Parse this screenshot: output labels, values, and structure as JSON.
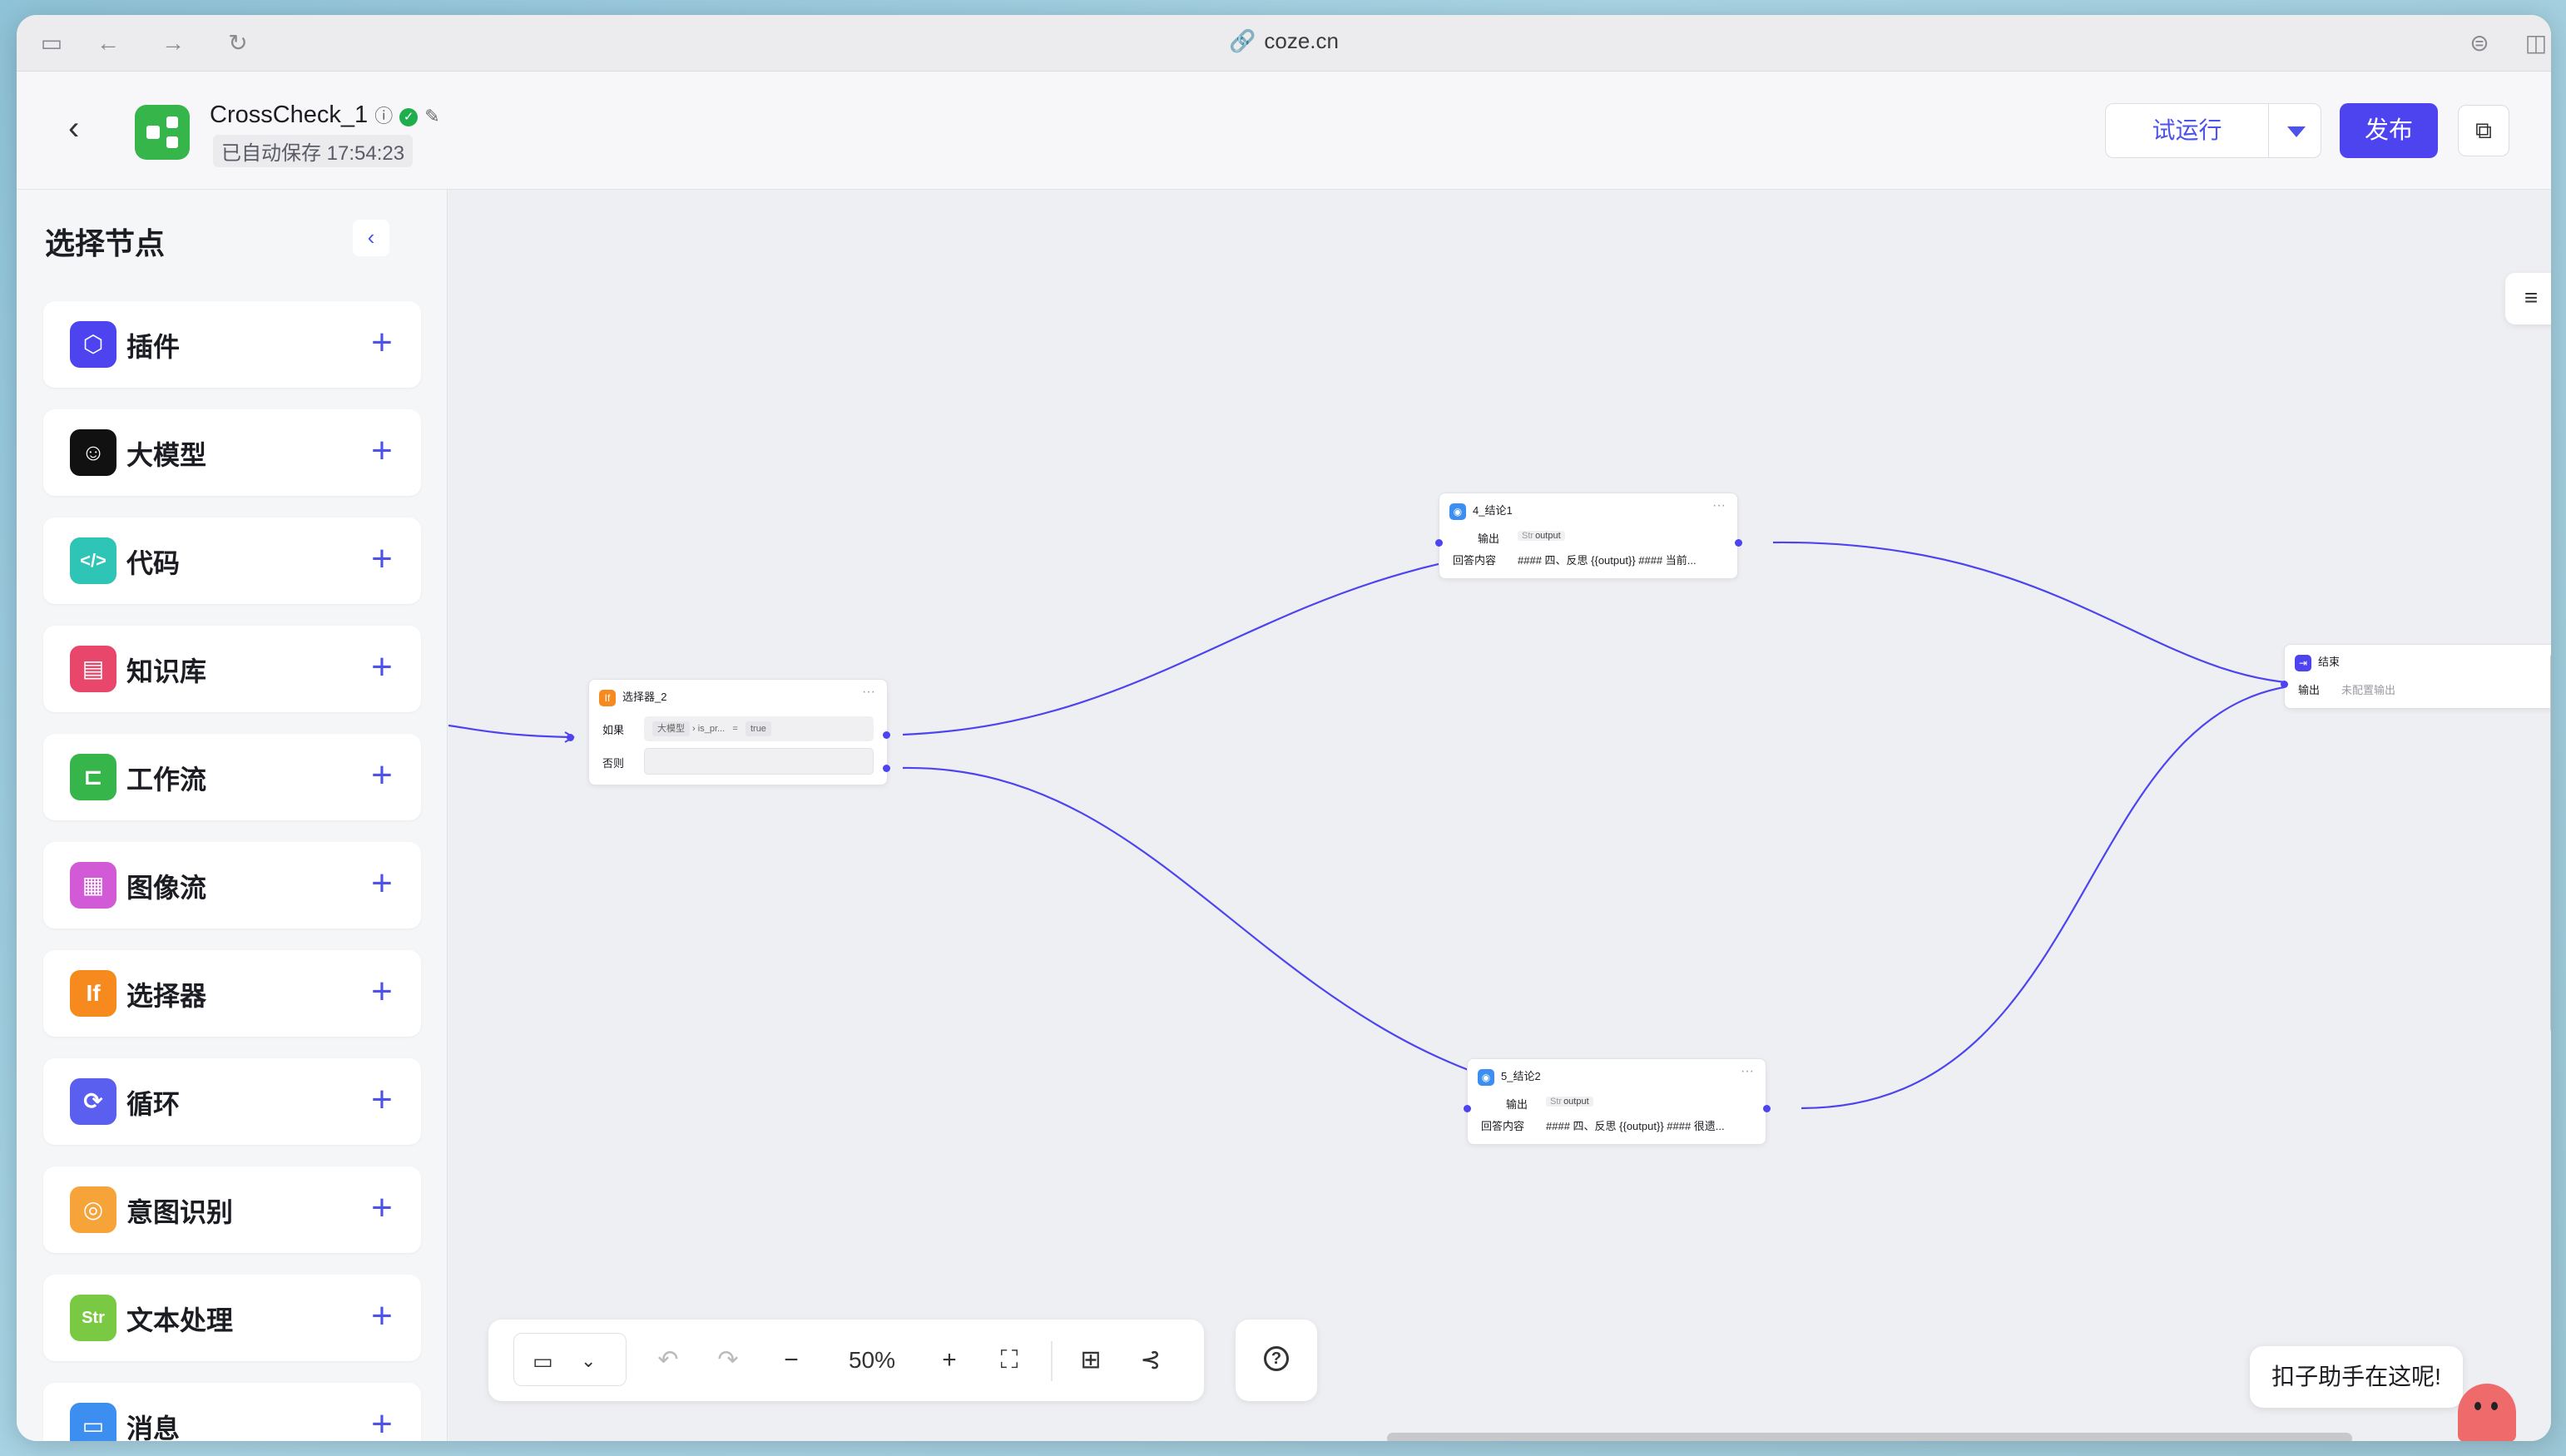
{
  "browser": {
    "url": "coze.cn"
  },
  "header": {
    "app_name": "CrossCheck_1",
    "saved_status": "已自动保存 17:54:23",
    "try_run_label": "试运行",
    "publish_label": "发布"
  },
  "sidebar": {
    "title": "选择节点",
    "items": [
      {
        "label": "插件",
        "icon": "plugin-icon",
        "color": "#4d44f0"
      },
      {
        "label": "大模型",
        "icon": "llm-icon",
        "color": "#111111"
      },
      {
        "label": "代码",
        "icon": "code-icon",
        "color": "#2ec4b6"
      },
      {
        "label": "知识库",
        "icon": "knowledge-icon",
        "color": "#e8466a"
      },
      {
        "label": "工作流",
        "icon": "workflow-icon",
        "color": "#35b54a"
      },
      {
        "label": "图像流",
        "icon": "imageflow-icon",
        "color": "#d35ad6"
      },
      {
        "label": "选择器",
        "icon": "selector-icon",
        "color": "#f68a1e"
      },
      {
        "label": "循环",
        "icon": "loop-icon",
        "color": "#5b5ff0"
      },
      {
        "label": "意图识别",
        "icon": "intent-icon",
        "color": "#f6a43a"
      },
      {
        "label": "文本处理",
        "icon": "text-process-icon",
        "color": "#7ac943"
      },
      {
        "label": "消息",
        "icon": "message-icon",
        "color": "#3c8ef0"
      }
    ]
  },
  "nodes": {
    "selector": {
      "title": "选择器_2",
      "if_label": "如果",
      "var1": "大模型",
      "var2": "is_pr...",
      "op": "=",
      "value": "true",
      "else_label": "否则"
    },
    "conclusion1": {
      "title": "4_结论1",
      "output_label": "输出",
      "output_type": "Str",
      "output_name": "output",
      "answer_label": "回答内容",
      "answer_value": "#### 四、反思 {{output}} #### 当前..."
    },
    "conclusion2": {
      "title": "5_结论2",
      "output_label": "输出",
      "output_type": "Str",
      "output_name": "output",
      "answer_label": "回答内容",
      "answer_value": "#### 四、反思 {{output}} #### 很遗..."
    },
    "end": {
      "title": "结束",
      "output_label": "输出",
      "output_value": "未配置输出"
    }
  },
  "toolbar": {
    "zoom": "50%"
  },
  "assistant": {
    "text": "扣子助手在这呢!"
  }
}
